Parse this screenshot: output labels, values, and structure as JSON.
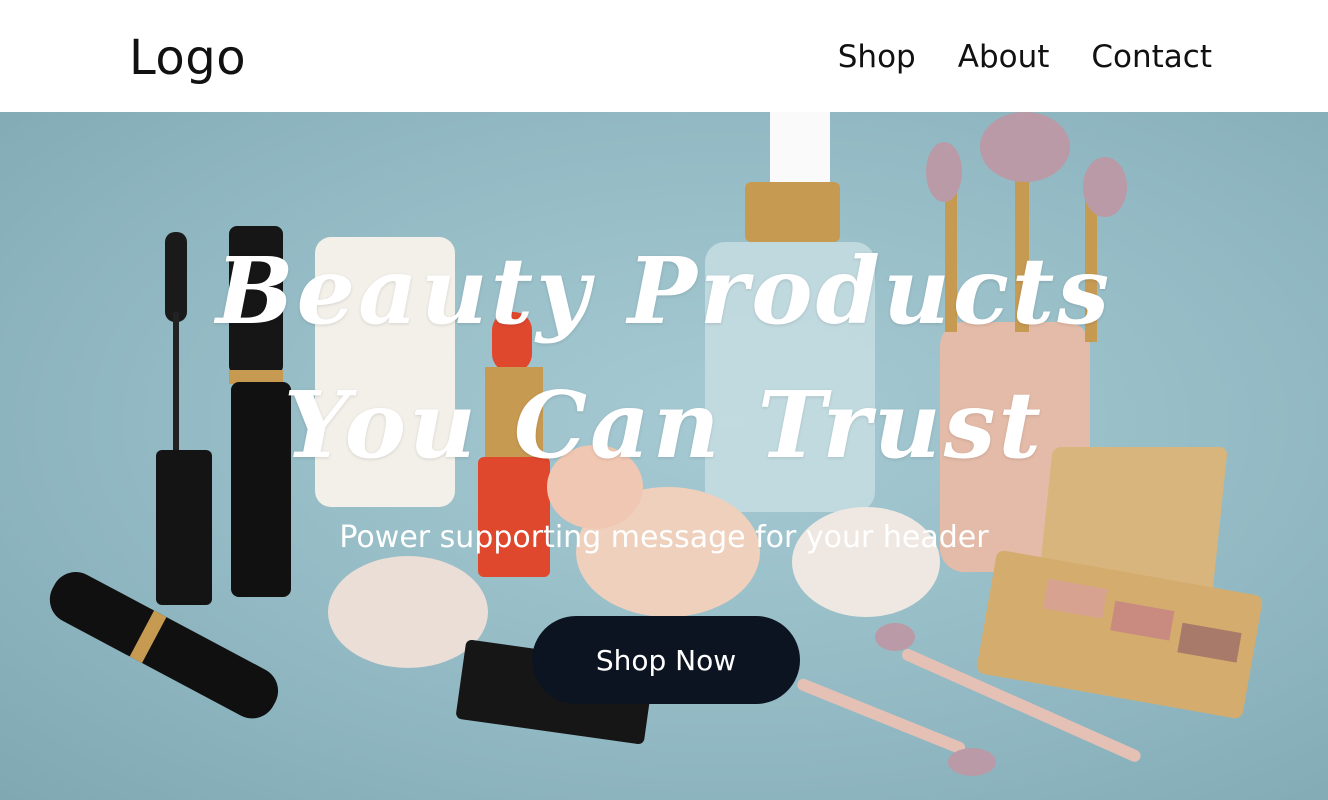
{
  "header": {
    "logo": "Logo",
    "nav": [
      "Shop",
      "About",
      "Contact"
    ]
  },
  "hero": {
    "headline_line1": "Beauty Products",
    "headline_line2": "You Can Trust",
    "subtext": "Power supporting message for your header",
    "cta_label": "Shop Now"
  },
  "colors": {
    "header_bg": "#ffffff",
    "hero_bg": "#93bac4",
    "cta_bg": "#0d1421",
    "text_on_hero": "#ffffff"
  }
}
